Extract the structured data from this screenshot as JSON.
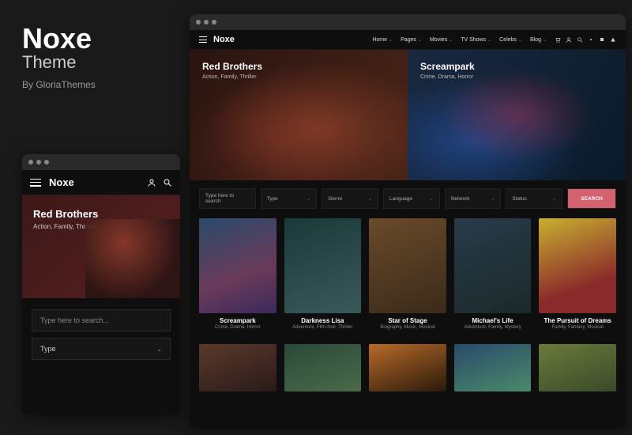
{
  "promo": {
    "title": "Noxe",
    "subtitle": "Theme",
    "byline": "By GloriaThemes"
  },
  "brand": "Noxe",
  "mobile": {
    "hero": {
      "title": "Red Brothers",
      "tags": "Action, Family, Thriller"
    },
    "search_placeholder": "Type here to search...",
    "filter_type": "Type"
  },
  "desktop": {
    "nav": [
      "Home",
      "Pages",
      "Movies",
      "TV Shows",
      "Celebs",
      "Blog"
    ],
    "hero": [
      {
        "title": "Red Brothers",
        "tags": "Action, Family, Thriller"
      },
      {
        "title": "Screampark",
        "tags": "Crime, Drama, Horror"
      }
    ],
    "filters": {
      "search_placeholder": "Type here to search",
      "items": [
        "Type",
        "Genre",
        "Language",
        "Network",
        "Status"
      ],
      "button": "SEARCH"
    },
    "cards": [
      {
        "title": "Screampark",
        "tags": "Crime, Drama, Horror",
        "bg": "linear-gradient(160deg,#2a4a6a,#6a3a5a 60%,#3a2a5a)"
      },
      {
        "title": "Darkness Lisa",
        "tags": "Adventure, Film-Noir, Thriller",
        "bg": "linear-gradient(160deg,#1a3a3a,#2a4a4a 50%,#3a5a5a)"
      },
      {
        "title": "Star of Stage",
        "tags": "Biography, Music, Musical",
        "bg": "linear-gradient(160deg,#6a4a2a,#3a2a1a)"
      },
      {
        "title": "Michael's Life",
        "tags": "Adventure, Family, Mystery",
        "bg": "linear-gradient(160deg,#2a3a4a,#1a2a2a)"
      },
      {
        "title": "The Pursuit of Dreams",
        "tags": "Family, Fantasy, Musical",
        "bg": "linear-gradient(160deg,#c8b030,#8a2a2a 70%)"
      }
    ],
    "cards2_bg": [
      "linear-gradient(160deg,#5a3a2a,#2a1a1a)",
      "linear-gradient(160deg,#2a4a3a,#4a6a4a)",
      "linear-gradient(160deg,#b86a2a,#2a1a0a)",
      "linear-gradient(160deg,#2a4a6a,#4a8a6a)",
      "linear-gradient(160deg,#6a7a3a,#3a4a2a)"
    ]
  }
}
